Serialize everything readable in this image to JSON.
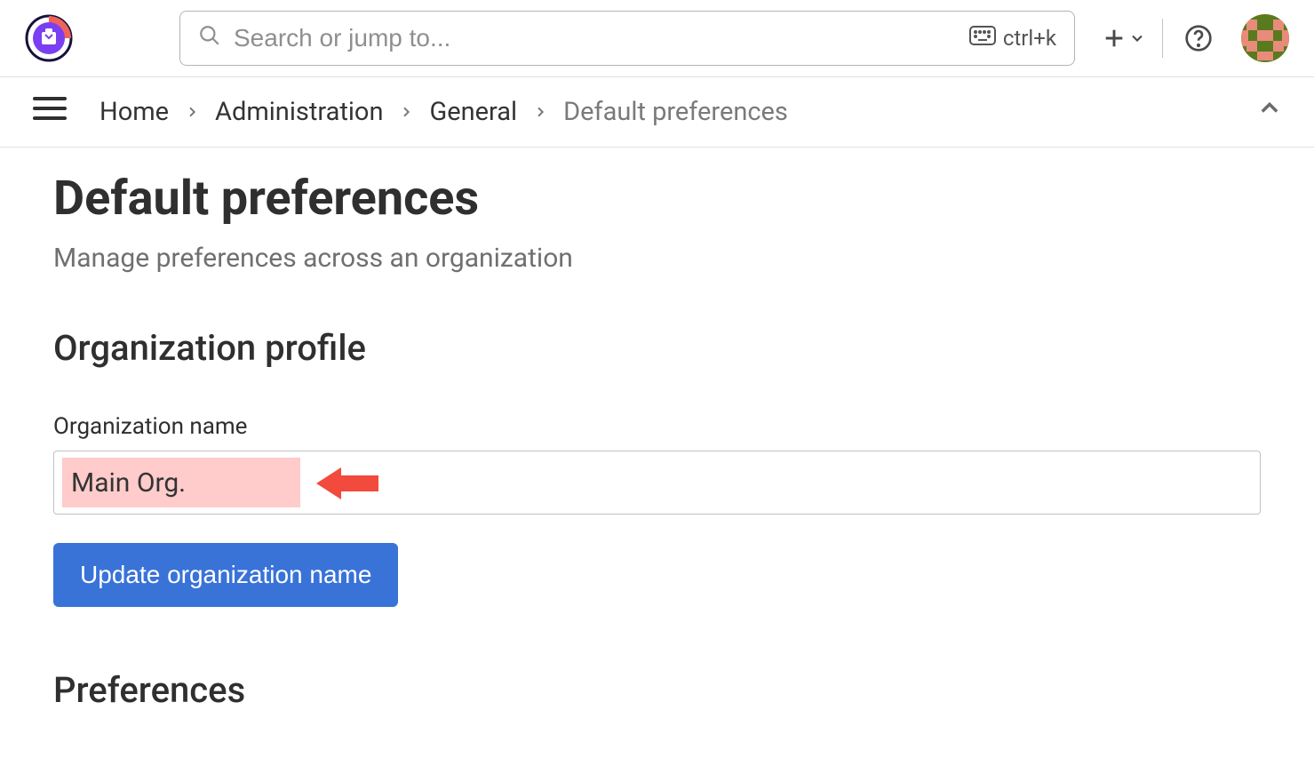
{
  "header": {
    "search_placeholder": "Search or jump to...",
    "shortcut_hint": "ctrl+k"
  },
  "breadcrumb": {
    "items": [
      {
        "label": "Home"
      },
      {
        "label": "Administration"
      },
      {
        "label": "General"
      },
      {
        "label": "Default preferences"
      }
    ]
  },
  "page": {
    "title": "Default preferences",
    "subtitle": "Manage preferences across an organization"
  },
  "org_profile": {
    "heading": "Organization profile",
    "name_label": "Organization name",
    "name_value": "Main Org.",
    "update_button": "Update organization name"
  },
  "preferences": {
    "heading": "Preferences"
  }
}
